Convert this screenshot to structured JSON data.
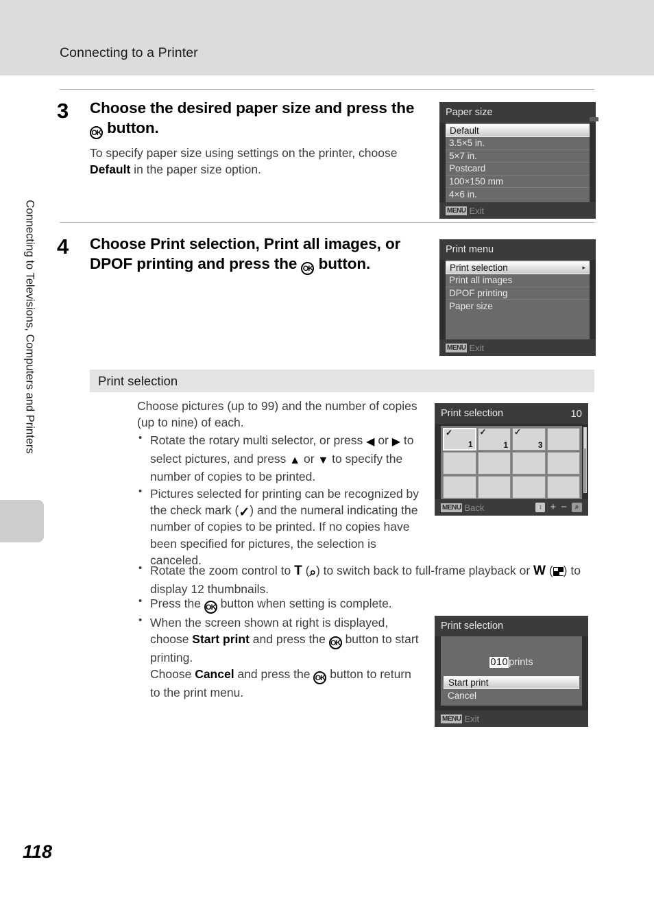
{
  "header": {
    "title": "Connecting to a Printer"
  },
  "sidebar": {
    "chapter": "Connecting to Televisions, Computers and Printers"
  },
  "footer": {
    "page_number": "118"
  },
  "steps": [
    {
      "number": "3",
      "heading_before": "Choose the desired paper size and press the ",
      "heading_icon": "ok-button-icon",
      "heading_after": " button.",
      "sub_before": "To specify paper size using settings on the printer, choose ",
      "sub_bold": "Default",
      "sub_after": " in the paper size option."
    },
    {
      "number": "4",
      "h_p1": "Choose ",
      "h_b1": "Print selection",
      "h_p2": ", ",
      "h_b2": "Print all images",
      "h_p3": ", or ",
      "h_b3": "DPOF printing",
      "h_p4": " and press the ",
      "h_p5": " button."
    }
  ],
  "section": {
    "title": "Print selection"
  },
  "body": {
    "intro": "Choose pictures (up to 99) and the number of copies (up to nine) of each.",
    "bullets": [
      {
        "p1": "Rotate the rotary multi selector, or press ",
        "i1": "◀",
        "p2": " or ",
        "i2": "▶",
        "p3": " to select pictures, and press ",
        "i3": "▲",
        "p4": " or ",
        "i4": "▼",
        "p5": " to specify the number of copies to be printed."
      },
      {
        "p1": "Pictures selected for printing can be recognized by the check mark (",
        "i1": "✓",
        "p2": ") and the numeral indicating the number of copies to be printed. If no copies have been specified for pictures, the selection is canceled."
      },
      {
        "p1": "Rotate the zoom control to ",
        "b1": "T",
        "p2": " (",
        "i1": "⌕",
        "p3": ") to switch back to full-frame playback or ",
        "b2": "W",
        "p4": " (",
        "i2": "thumbnail-grid-icon",
        "p5": ") to display 12 thumbnails."
      },
      {
        "p1": "Press the ",
        "i1": "ok-button-icon",
        "p2": " button when setting is complete."
      },
      {
        "p1": "When the screen shown at right is displayed, choose ",
        "b1": "Start print",
        "p2": " and press the ",
        "i1": "ok-button-icon",
        "p3": " button to start printing.",
        "p4": "Choose ",
        "b2": "Cancel",
        "p5": " and press the ",
        "i2": "ok-button-icon",
        "p6": " button to return to the print menu."
      }
    ]
  },
  "screens": {
    "paper_size": {
      "title": "Paper size",
      "battery_icon": "battery-icon",
      "items": [
        {
          "label": "Default",
          "selected": true
        },
        {
          "label": "3.5×5 in.",
          "selected": false
        },
        {
          "label": "5×7 in.",
          "selected": false
        },
        {
          "label": "Postcard",
          "selected": false
        },
        {
          "label": "100×150 mm",
          "selected": false
        },
        {
          "label": "4×6 in.",
          "selected": false
        }
      ],
      "footer_badge": "MENU",
      "footer_label": "Exit"
    },
    "print_menu": {
      "title": "Print menu",
      "items": [
        {
          "label": "Print selection",
          "selected": true,
          "arrow": "▸"
        },
        {
          "label": "Print all images",
          "selected": false,
          "arrow": ""
        },
        {
          "label": "DPOF printing",
          "selected": false,
          "arrow": ""
        },
        {
          "label": "Paper size",
          "selected": false,
          "arrow": ""
        }
      ],
      "footer_badge": "MENU",
      "footer_label": "Exit"
    },
    "print_selection_grid": {
      "title": "Print selection",
      "count": "10",
      "thumbnails": [
        {
          "check": "✓",
          "copies": "1",
          "active": true
        },
        {
          "check": "✓",
          "copies": "1",
          "active": false
        },
        {
          "check": "✓",
          "copies": "3",
          "active": false
        },
        {
          "check": "",
          "copies": "",
          "active": false
        },
        {
          "check": "",
          "copies": "",
          "active": false
        },
        {
          "check": "",
          "copies": "",
          "active": false
        },
        {
          "check": "",
          "copies": "",
          "active": false
        },
        {
          "check": "",
          "copies": "",
          "active": false
        },
        {
          "check": "",
          "copies": "",
          "active": false
        },
        {
          "check": "",
          "copies": "",
          "active": false
        },
        {
          "check": "",
          "copies": "",
          "active": false
        },
        {
          "check": "",
          "copies": "",
          "active": false
        }
      ],
      "footer_badge": "MENU",
      "footer_label": "Back",
      "icons": {
        "updown": "↕",
        "plus": "+",
        "minus": "−",
        "magnify": "⌕"
      }
    },
    "print_confirm": {
      "title": "Print selection",
      "count_value": "010",
      "count_unit": "prints",
      "buttons": [
        {
          "label": "Start print",
          "selected": true
        },
        {
          "label": "Cancel",
          "selected": false
        }
      ],
      "footer_badge": "MENU",
      "footer_label": "Exit"
    }
  }
}
